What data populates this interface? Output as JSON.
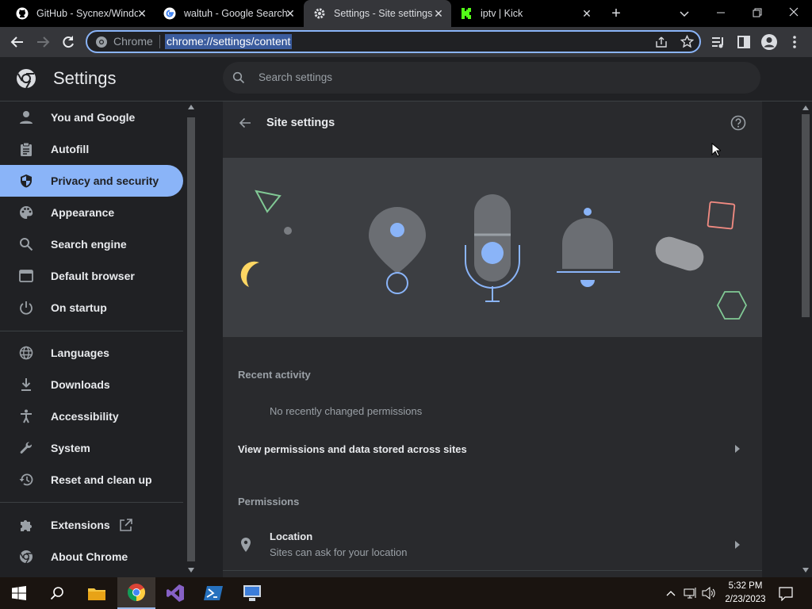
{
  "tabs": [
    {
      "title": "GitHub - Sycnex/Windo",
      "icon": "github-icon"
    },
    {
      "title": "waltuh - Google Search",
      "icon": "google-icon"
    },
    {
      "title": "Settings - Site settings",
      "icon": "settings-gear-icon"
    },
    {
      "title": "iptv | Kick",
      "icon": "kick-icon"
    }
  ],
  "omnibox": {
    "chip": "Chrome",
    "url": "chrome://settings/content"
  },
  "app": {
    "title": "Settings",
    "search_placeholder": "Search settings"
  },
  "sidebar": {
    "items": [
      {
        "label": "You and Google",
        "icon": "person-icon"
      },
      {
        "label": "Autofill",
        "icon": "clipboard-icon"
      },
      {
        "label": "Privacy and security",
        "icon": "shield-icon"
      },
      {
        "label": "Appearance",
        "icon": "palette-icon"
      },
      {
        "label": "Search engine",
        "icon": "search-icon"
      },
      {
        "label": "Default browser",
        "icon": "browser-icon"
      },
      {
        "label": "On startup",
        "icon": "power-icon"
      },
      {
        "label": "Languages",
        "icon": "globe-icon"
      },
      {
        "label": "Downloads",
        "icon": "download-icon"
      },
      {
        "label": "Accessibility",
        "icon": "accessibility-icon"
      },
      {
        "label": "System",
        "icon": "wrench-icon"
      },
      {
        "label": "Reset and clean up",
        "icon": "restore-icon"
      },
      {
        "label": "Extensions",
        "icon": "puzzle-icon"
      },
      {
        "label": "About Chrome",
        "icon": "chrome-icon"
      }
    ]
  },
  "content": {
    "page_title": "Site settings",
    "recent_activity_heading": "Recent activity",
    "no_recent": "No recently changed permissions",
    "view_permissions": "View permissions and data stored across sites",
    "permissions_heading": "Permissions",
    "location_title": "Location",
    "location_sub": "Sites can ask for your location"
  },
  "taskbar": {
    "time": "5:32 PM",
    "date": "2/23/2023"
  },
  "colors": {
    "accent": "#8ab4f8",
    "background": "#202124",
    "card": "#292a2d"
  }
}
